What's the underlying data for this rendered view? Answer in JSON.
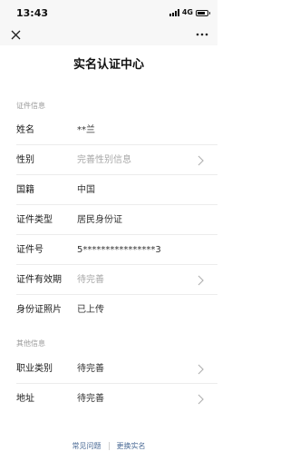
{
  "status_bar": {
    "time": "13:43",
    "network": "4G"
  },
  "page": {
    "title": "实名认证中心"
  },
  "sections": [
    {
      "label": "证件信息",
      "rows": [
        {
          "label": "姓名",
          "value": "**兰",
          "placeholder": false,
          "chevron": false
        },
        {
          "label": "性别",
          "value": "完善性别信息",
          "placeholder": true,
          "chevron": true
        },
        {
          "label": "国籍",
          "value": "中国",
          "placeholder": false,
          "chevron": false
        },
        {
          "label": "证件类型",
          "value": "居民身份证",
          "placeholder": false,
          "chevron": false
        },
        {
          "label": "证件号",
          "value": "5****************3",
          "placeholder": false,
          "chevron": false
        },
        {
          "label": "证件有效期",
          "value": "待完善",
          "placeholder": true,
          "chevron": true
        },
        {
          "label": "身份证照片",
          "value": "已上传",
          "placeholder": false,
          "chevron": false
        }
      ]
    },
    {
      "label": "其他信息",
      "rows": [
        {
          "label": "职业类别",
          "value": "待完善",
          "placeholder": false,
          "chevron": true
        },
        {
          "label": "地址",
          "value": "待完善",
          "placeholder": false,
          "chevron": true
        }
      ]
    }
  ],
  "footer": {
    "faq": "常见问题",
    "change_name": "更换实名"
  },
  "icons": {
    "close": "close-icon",
    "more": "more-icon",
    "chevron": "chevron-right-icon"
  },
  "colors": {
    "link": "#4a6a95",
    "placeholder": "#a8a8a8",
    "section_label": "#9a9a9a"
  }
}
